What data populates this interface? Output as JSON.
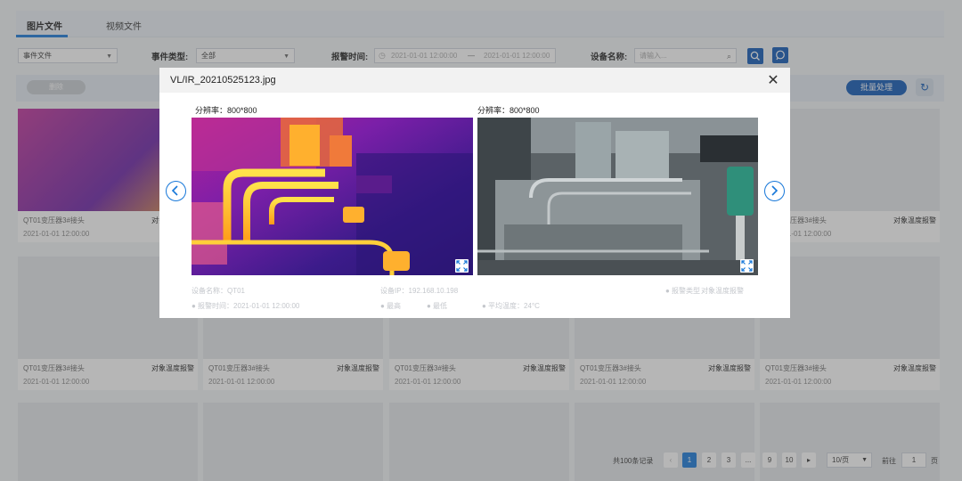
{
  "tabs": {
    "images": "图片文件",
    "videos": "视频文件"
  },
  "filters": {
    "file_type": "事件文件",
    "event_type_label": "事件类型:",
    "event_type_value": "全部",
    "alarm_time_label": "报警时间:",
    "time_start": "2021-01-01 12:00:00",
    "time_sep": "—",
    "time_end": "2021-01-01 12:00:00",
    "device_label": "设备名称:",
    "device_placeholder": "请输入..."
  },
  "actions": {
    "delete": "删除",
    "batch": "批量处理"
  },
  "cards": {
    "title": "QT01变压器3#接头",
    "alarm": "对象温度报警",
    "time": "2021-01-01 12:00:00"
  },
  "pagination": {
    "total": "共100条记录",
    "pages": [
      "1",
      "2",
      "3",
      "...",
      "9",
      "10"
    ],
    "active_page": "1",
    "page_size": "10/页",
    "goto_label": "前往",
    "goto_value": "1",
    "page_unit": "页"
  },
  "modal": {
    "title": "VL/IR_20210525123.jpg",
    "left_resolution": "分辨率：800*800",
    "right_resolution": "分辨率：800*800",
    "faint_texts": {
      "device": "设备名称：QT01",
      "ip": "设备IP：192.168.10.198",
      "alarm_tag": "对象温度报警",
      "alarm_type": "● 报警类型",
      "time": "● 报警时间：2021-01-01 12:00:00",
      "max": "● 最高",
      "min": "● 最低",
      "temp": "● 平均温度：24°C",
      "avg": "平均温度：24°C"
    }
  },
  "colors": {
    "accent": "#1677d9",
    "primary": "#0d57b5"
  },
  "icons": [
    "close-icon",
    "expand-icon",
    "chevron-left-icon",
    "chevron-right-icon",
    "search-icon",
    "refresh-icon",
    "calendar-icon"
  ]
}
